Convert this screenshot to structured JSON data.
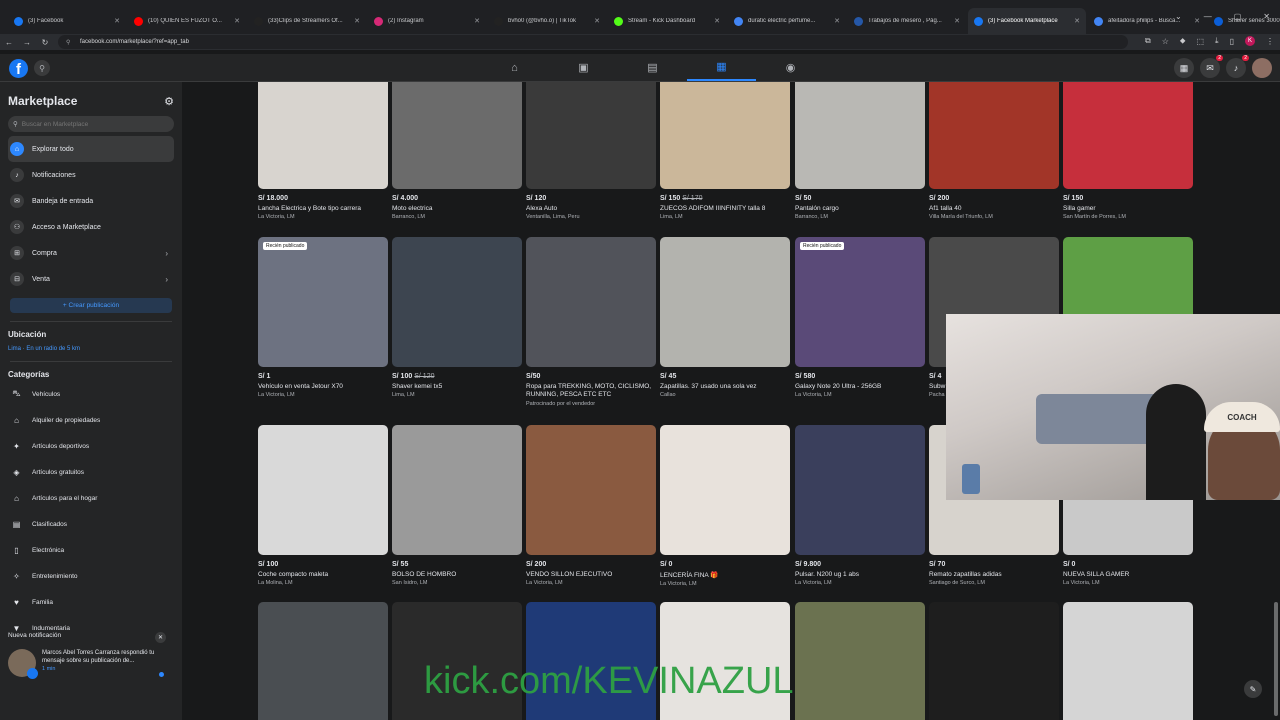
{
  "browser": {
    "tabs": [
      {
        "title": "(3) Facebook",
        "color": "#1877f2"
      },
      {
        "title": "(10) QUIEN ES FUZOT O...",
        "color": "#ff0000"
      },
      {
        "title": "(33)Clips de Streamers Of...",
        "color": "#222222"
      },
      {
        "title": "(2) Instagram",
        "color": "#d62976"
      },
      {
        "title": "bvho0 (@bvho.o) | TikTok",
        "color": "#222222"
      },
      {
        "title": "Stream - Kick Dashboard",
        "color": "#53fc18"
      },
      {
        "title": "duratic electric perfume...",
        "color": "#4285f4"
      },
      {
        "title": "Trabajos de mesero , Pág...",
        "color": "#2557a7"
      },
      {
        "title": "(3) Facebook Marketplace",
        "color": "#1877f2",
        "active": true
      },
      {
        "title": "afeitadora philips - Busca...",
        "color": "#4285f4"
      },
      {
        "title": "Shaver series 3000 Afeita...",
        "color": "#0b5ed7"
      }
    ],
    "url": "facebook.com/marketplace/?ref=app_tab",
    "profile_initial": "K"
  },
  "fb": {
    "notif_badges": [
      "2",
      "2"
    ]
  },
  "sidebar": {
    "title": "Marketplace",
    "search_placeholder": "Buscar en Marketplace",
    "items": [
      {
        "label": "Explorar todo"
      },
      {
        "label": "Notificaciones"
      },
      {
        "label": "Bandeja de entrada"
      },
      {
        "label": "Acceso a Marketplace"
      },
      {
        "label": "Compra"
      },
      {
        "label": "Venta"
      }
    ],
    "create_label": "+ Crear publicación",
    "location_heading": "Ubicación",
    "location_value": "Lima · En un radio de 5 km",
    "categories_heading": "Categorías",
    "categories": [
      {
        "label": "Vehículos",
        "icon": "car-icon"
      },
      {
        "label": "Alquiler de propiedades",
        "icon": "house-icon"
      },
      {
        "label": "Artículos deportivos",
        "icon": "sports-icon"
      },
      {
        "label": "Artículos gratuitos",
        "icon": "tag-icon"
      },
      {
        "label": "Artículos para el hogar",
        "icon": "home-icon"
      },
      {
        "label": "Clasificados",
        "icon": "classifieds-icon"
      },
      {
        "label": "Electrónica",
        "icon": "phone-icon"
      },
      {
        "label": "Entretenimiento",
        "icon": "entertainment-icon"
      },
      {
        "label": "Familia",
        "icon": "heart-icon"
      },
      {
        "label": "Indumentaria",
        "icon": "shirt-icon"
      }
    ]
  },
  "notification": {
    "heading": "Nueva notificación",
    "text": "Marcos Abel Torres Carranza respondió tu mensaje sobre su publicación de...",
    "time": "1 min"
  },
  "listings": [
    {
      "price": "S/ 18.000",
      "title": "Lancha Electrica y Bote tipo carrera",
      "loc": "La Victoria, LM",
      "bg": "#d8d4cf"
    },
    {
      "price": "S/ 4.000",
      "title": "Moto electrica",
      "loc": "Barranco, LM",
      "bg": "#6b6b6b"
    },
    {
      "price": "S/ 120",
      "title": "Alexa Auto",
      "loc": "Ventanilla, Lima, Peru",
      "bg": "#3a3a3a"
    },
    {
      "price": "S/ 150",
      "old": "S/ 170",
      "title": "ZUECOS ADIFOM IIINFINITY talla 8",
      "loc": "Lima, LM",
      "bg": "#cbb79a"
    },
    {
      "price": "S/ 50",
      "title": "Pantalón cargo",
      "loc": "Barranco, LM",
      "bg": "#b9b8b4"
    },
    {
      "price": "S/ 200",
      "title": "Af1 talla 40",
      "loc": "Villa María del Triunfo, LM",
      "bg": "#a23528"
    },
    {
      "price": "S/ 150",
      "title": "Silla gamer",
      "loc": "San Martín de Porres, LM",
      "bg": "#c62f3c"
    },
    {
      "price": "S/ 1",
      "title": "Vehículo en venta Jetour X70",
      "loc": "La Victoria, LM",
      "bg": "#6d7281",
      "badge": "Recién publicado"
    },
    {
      "price": "S/ 100",
      "old": "S/ 120",
      "title": "Shaver kemei tx5",
      "loc": "Lima, LM",
      "bg": "#3d4550"
    },
    {
      "price": "S/50",
      "title": "Ropa para TREKKING, MOTO, CICLISMO, RUNNING, PESCA ETC ETC",
      "loc": "Patrocinado por el vendedor",
      "bg": "#51535a",
      "wrap": true
    },
    {
      "price": "S/ 45",
      "title": "Zapatillas. 37 usado una sola vez",
      "loc": "Callao",
      "bg": "#b3b3ae"
    },
    {
      "price": "S/ 580",
      "title": "Galaxy Note 20 Ultra - 256GB",
      "loc": "La Victoria, LM",
      "bg": "#5a4a78",
      "badge": "Recién publicado"
    },
    {
      "price": "S/ 4",
      "title": "Subw",
      "loc": "Pacha",
      "bg": "#4a4a4a"
    },
    {
      "price": "",
      "title": "",
      "loc": "",
      "bg": "#5e9f45"
    },
    {
      "price": "S/ 100",
      "title": "Coche compacto maleta",
      "loc": "La Molina, LM",
      "bg": "#d9d9d9"
    },
    {
      "price": "S/ 55",
      "title": "BOLSO DE HOMBRO",
      "loc": "San Isidro, LM",
      "bg": "#9a9a9a"
    },
    {
      "price": "S/ 200",
      "title": "VENDO SILLON EJECUTIVO",
      "loc": "La Victoria, LM",
      "bg": "#8a5a40"
    },
    {
      "price": "S/ 0",
      "title": "LENCERÍA FINA 🎁",
      "loc": "La Victoria, LM",
      "bg": "#e8e2dc"
    },
    {
      "price": "S/ 9.800",
      "title": "Pulsar. N200 ug 1 abs",
      "loc": "La Victoria, LM",
      "bg": "#3a3f5c"
    },
    {
      "price": "S/ 70",
      "title": "Remato zapatillas adidas",
      "loc": "Santiago de Surco, LM",
      "bg": "#d7d3cd"
    },
    {
      "price": "S/ 0",
      "title": "NUEVA SILLA GAMER",
      "loc": "La Victoria, LM",
      "bg": "#c9c9c9"
    },
    {
      "price": "",
      "title": "",
      "loc": "",
      "bg": "#4a4e52"
    },
    {
      "price": "",
      "title": "",
      "loc": "",
      "bg": "#2a2a2a"
    },
    {
      "price": "",
      "title": "",
      "loc": "",
      "bg": "#1f3a77"
    },
    {
      "price": "",
      "title": "",
      "loc": "",
      "bg": "#e6e3df"
    },
    {
      "price": "",
      "title": "",
      "loc": "",
      "bg": "#6b7250"
    },
    {
      "price": "",
      "title": "",
      "loc": "",
      "bg": "#1e1e1e"
    },
    {
      "price": "",
      "title": "",
      "loc": "",
      "bg": "#d5d5d5"
    }
  ],
  "webcam": {
    "cap_text": "COACH"
  },
  "overlay_text": "kick.com/KEVINAZUL"
}
